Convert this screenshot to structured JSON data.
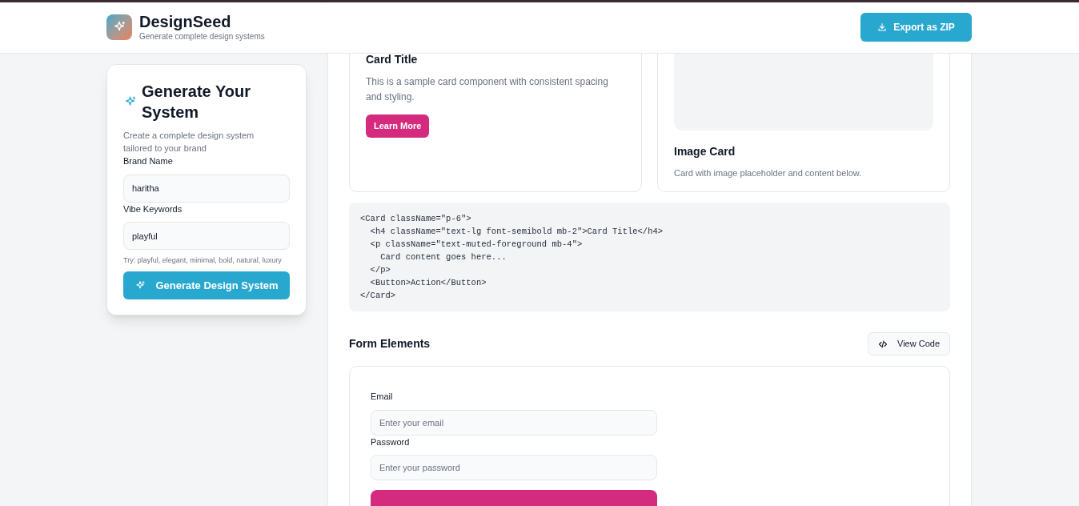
{
  "header": {
    "app_name": "DesignSeed",
    "tagline": "Generate complete design systems",
    "export_button": "Export as ZIP"
  },
  "generator": {
    "title": "Generate Your System",
    "subtitle": "Create a complete design system tailored to your brand",
    "fields": [
      {
        "label": "Brand Name",
        "value": "haritha"
      },
      {
        "label": "Vibe Keywords",
        "value": "playful"
      }
    ],
    "hint": "Try: playful, elegant, minimal, bold, natural, luxury",
    "button": "Generate Design System"
  },
  "cards": [
    {
      "kind": "text",
      "title": "Card Title",
      "description": "This is a sample card component with consistent spacing and styling.",
      "button": "Learn More"
    },
    {
      "kind": "image",
      "title": "Image Card",
      "description": "Card with image placeholder and content below."
    }
  ],
  "code_block": [
    "<Card className=\"p-6\">",
    "  <h4 className=\"text-lg font-semibold mb-2\">Card Title</h4>",
    "  <p className=\"text-muted-foreground mb-4\">",
    "    Card content goes here...",
    "  </p>",
    "  <Button>Action</Button>",
    "</Card>"
  ],
  "form_section": {
    "title": "Form Elements",
    "view_code_button": "View Code",
    "fields": [
      {
        "label": "Email",
        "placeholder": "Enter your email"
      },
      {
        "label": "Password",
        "placeholder": "Enter your password"
      }
    ]
  }
}
